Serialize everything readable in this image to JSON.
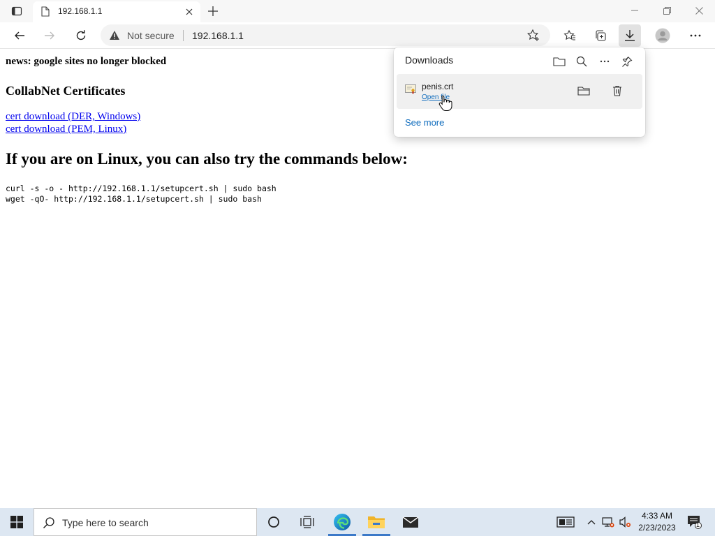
{
  "browser": {
    "tab_title": "192.168.1.1",
    "address": {
      "security_text": "Not secure",
      "url": "192.168.1.1"
    }
  },
  "page": {
    "news": "news: google sites no longer blocked",
    "heading_certs": "CollabNet Certificates",
    "links": [
      "cert download (DER, Windows)",
      "cert download (PEM, Linux)"
    ],
    "heading_linux": "If you are on Linux, you can also try the commands below:",
    "commands": [
      "curl -s -o - http://192.168.1.1/setupcert.sh | sudo bash",
      "wget -qO- http://192.168.1.1/setupcert.sh | sudo bash"
    ]
  },
  "downloads": {
    "title": "Downloads",
    "items": [
      {
        "filename": "penis.crt",
        "action": "Open file"
      }
    ],
    "see_more": "See more"
  },
  "taskbar": {
    "search_placeholder": "Type here to search",
    "time": "4:33 AM",
    "date": "2/23/2023",
    "notification_count": "1"
  },
  "colors": {
    "link": "#0000ee",
    "accent": "#0f6cbd",
    "taskbar_bg": "#dde7f2"
  }
}
